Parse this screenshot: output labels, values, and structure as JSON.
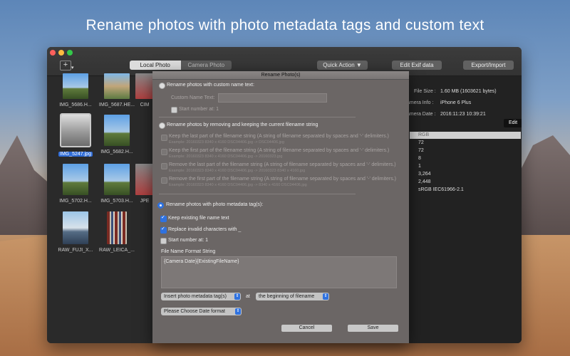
{
  "headline": "Rename photos with photo metadata tags and custom text",
  "toolbar": {
    "add_label": "+",
    "tabs": [
      {
        "label": "Local Photo",
        "selected": true
      },
      {
        "label": "Camera Photo",
        "selected": false
      }
    ],
    "quick_action_label": "Quick Action ▼",
    "edit_exif_label": "Edit Exif data",
    "export_import_label": "Export/Import"
  },
  "thumbnails": [
    {
      "caption": "IMG_5686.H...",
      "style": "sky"
    },
    {
      "caption": "IMG_5687.HE...",
      "style": "bldg"
    },
    {
      "caption": "CIM",
      "style": "peek"
    },
    {
      "caption": "IMG_5247.jpg",
      "style": "room",
      "selected": true
    },
    {
      "caption": "IMG_5682.H...",
      "style": "sky"
    },
    {
      "caption": "IMG_5702.H...",
      "style": "sky"
    },
    {
      "caption": "IMG_5703.H...",
      "style": "sky"
    },
    {
      "caption": "JPE",
      "style": "peek"
    },
    {
      "caption": "RAW_FUJI_X...",
      "style": "beach"
    },
    {
      "caption": "RAW_LEICA_...",
      "style": "books"
    }
  ],
  "info_panel": {
    "file_size_label": "File Size :",
    "file_size_value": "1.60 MB (1603621 bytes)",
    "camera_info_label": "amera Info :",
    "camera_info_value": "iPhone 6 Plus",
    "camera_date_label": "amera Date :",
    "camera_date_value": "2016:11:23 10:39:21",
    "edit_label": "Edit",
    "props": [
      "RGB",
      "72",
      "72",
      "8",
      "1",
      "3,264",
      "2,448",
      "sRGB IEC61966-2.1"
    ]
  },
  "dialog": {
    "title": "Rename Photo(s)",
    "opt_custom_label": "Rename photos with custom name text:",
    "custom_name_label": "Custom Name Text:",
    "custom_name_value": "",
    "start_number_label": "Start number at: 1",
    "opt_remove_label": "Rename photos by removing and keeping the current filename string",
    "remove_options": [
      {
        "label": "Keep the last part of the filename string (A string of filename separated by spaces and '-' delimiters.)",
        "example": "Example: 20160323 8340 x 4160 DSC04406.jpg -> DSC04406.jpg"
      },
      {
        "label": "Keep the first part of the filename string (A string of filename separated by spaces and '-' delimiters.)",
        "example": "Example: 20160323 8340 x 4160 DSC04406.jpg -> 20160323.jpg"
      },
      {
        "label": "Remove the last part of the filename string (A string of filename separated by spaces and '-' delimiters.)",
        "example": "Example: 20160323 8340 x 4160 DSC04406.jpg -> 20160323 8340 x 4160.jpg"
      },
      {
        "label": "Remove the first part of the filename string (A string of filename separated by spaces and '-' delimiters.)",
        "example": "Example: 20160323 8340 x 4160 DSC04406.jpg -> 8340 x 4160 DSC04406.jpg"
      }
    ],
    "opt_metadata_label": "Rename photos with photo metadata tag(s):",
    "keep_existing_label": "Keep existing file name text",
    "replace_invalid_label": "Replace invalid characters with _",
    "start_number2_label": "Start number at: 1",
    "format_label": "File Name Format String",
    "format_value": "{Camera Date}{ExistingFileName}",
    "insert_tag_label": "Insert photo metadata tag(s)",
    "at_label": "at",
    "position_label": "the beginning of filename",
    "date_format_label": "Please Choose Date format",
    "cancel_label": "Cancel",
    "save_label": "Save"
  }
}
